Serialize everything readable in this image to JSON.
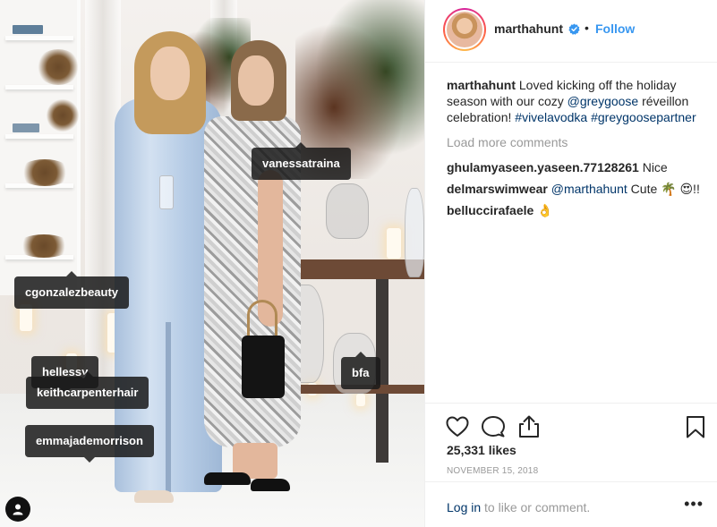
{
  "post": {
    "username": "marthahunt",
    "follow_label": "Follow",
    "separator": "•",
    "caption_text_1": " Loved kicking off the holiday season with our cozy ",
    "caption_mention": "@greygoose",
    "caption_text_2": " réveillon celebration! ",
    "caption_hashtag_1": "#vivelavodka",
    "caption_hashtag_2": "#greygoosepartner",
    "load_more": "Load more comments",
    "comments": [
      {
        "user": "ghulamyaseen.yaseen.77128261",
        "text": " Nice"
      },
      {
        "user": "delmarswimwear",
        "mention": "@marthahunt",
        "text": " Cute 🌴 😍!!"
      },
      {
        "user": "belluccirafaele",
        "text": " 👌"
      }
    ],
    "likes": "25,331 likes",
    "date": "NOVEMBER 15, 2018",
    "login_link": "Log in",
    "login_text": " to like or comment.",
    "more_label": "•••"
  },
  "tags": {
    "t1": "vanessatraina",
    "t2": "cgonzalezbeauty",
    "t3": "hellessy",
    "t4": "keithcarpenterhair",
    "t5": "bfa",
    "t6": "emmajademorrison"
  },
  "icons": {
    "heart": "heart-icon",
    "comment": "comment-icon",
    "share": "share-icon",
    "bookmark": "bookmark-icon",
    "verified": "verified-badge-icon",
    "user_tag": "user-tag-icon"
  },
  "colors": {
    "link_blue": "#3897f0",
    "text": "#262626",
    "muted": "#999999",
    "mention": "#003569"
  }
}
